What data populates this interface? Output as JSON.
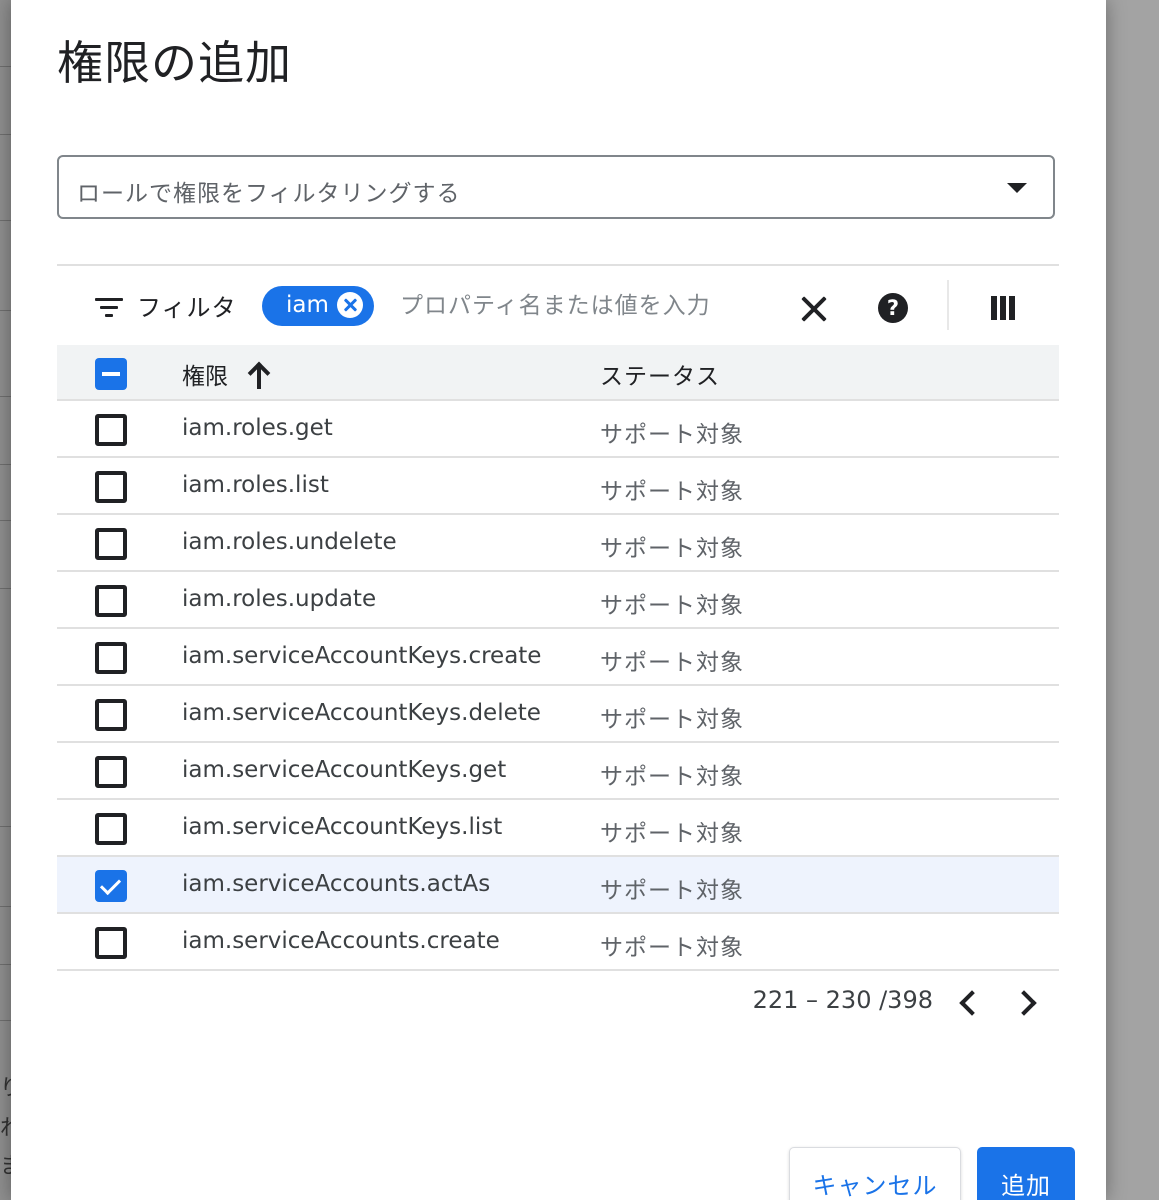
{
  "dialog": {
    "title": "権限の追加",
    "role_filter": {
      "placeholder": "ロールで権限をフィルタリングする"
    },
    "filter_bar": {
      "label": "フィルタ",
      "chip": "iam",
      "input_placeholder": "プロパティ名または値を入力",
      "input_value": ""
    },
    "table": {
      "columns": [
        "権限",
        "ステータス"
      ],
      "sort": {
        "column": "権限",
        "direction": "ascending"
      },
      "header_checkbox_state": "indeterminate",
      "rows": [
        {
          "permission": "iam.roles.get",
          "status": "サポート対象",
          "checked": false
        },
        {
          "permission": "iam.roles.list",
          "status": "サポート対象",
          "checked": false
        },
        {
          "permission": "iam.roles.undelete",
          "status": "サポート対象",
          "checked": false
        },
        {
          "permission": "iam.roles.update",
          "status": "サポート対象",
          "checked": false
        },
        {
          "permission": "iam.serviceAccountKeys.create",
          "status": "サポート対象",
          "checked": false
        },
        {
          "permission": "iam.serviceAccountKeys.delete",
          "status": "サポート対象",
          "checked": false
        },
        {
          "permission": "iam.serviceAccountKeys.get",
          "status": "サポート対象",
          "checked": false
        },
        {
          "permission": "iam.serviceAccountKeys.list",
          "status": "サポート対象",
          "checked": false
        },
        {
          "permission": "iam.serviceAccounts.actAs",
          "status": "サポート対象",
          "checked": true
        },
        {
          "permission": "iam.serviceAccounts.create",
          "status": "サポート対象",
          "checked": false
        }
      ]
    },
    "pagination": {
      "range": "221 – 230 /398"
    },
    "buttons": {
      "cancel": "キャンセル",
      "add": "追加"
    }
  },
  "background_glyphs": [
    "り",
    "れ",
    "ま"
  ],
  "colors": {
    "accent": "#1a73e8",
    "selected_row": "#eef3fd",
    "header_bg": "#f1f3f4",
    "divider": "#e0e0e0"
  },
  "icons": [
    "filter-icon",
    "chip-close-icon",
    "clear-icon",
    "help-icon",
    "columns-icon",
    "sort-ascending-icon",
    "dropdown-caret-icon",
    "chevron-left-icon",
    "chevron-right-icon"
  ]
}
